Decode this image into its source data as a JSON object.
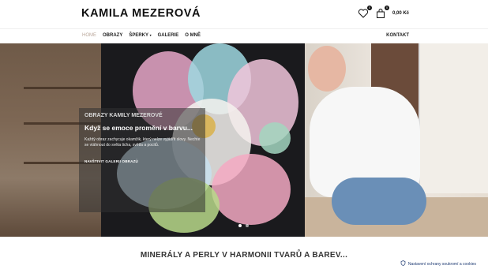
{
  "header": {
    "logo": "KAMILA MEZEROVÁ",
    "wishlist_count": "0",
    "cart_count": "0",
    "cart_total": "0,00 Kč"
  },
  "nav": {
    "items": [
      {
        "label": "HOME",
        "active": true
      },
      {
        "label": "OBRAZY"
      },
      {
        "label": "ŠPERKY"
      },
      {
        "label": "GALERIE"
      },
      {
        "label": "O MNĚ"
      }
    ],
    "right_item": "KONTAKT"
  },
  "hero": {
    "subtitle": "OBRAZY KAMILY MEZEROVÉ",
    "title": "Když se emoce promění v barvu...",
    "text": "Každý obraz zachycuje okamžik, který nelze vyjádřit slovy. Nechte se vtáhnout do světa ticha, světla a pocitů.",
    "button": "NAVŠTIVIT GALERII OBRAZŮ",
    "slides": [
      {
        "active": true
      },
      {
        "active": false
      }
    ]
  },
  "section": {
    "title": "MINERÁLY A PERLY V HARMONII TVARŮ A BAREV..."
  },
  "cookie": {
    "label": "Nastavení ochrany soukromí a cookies"
  }
}
